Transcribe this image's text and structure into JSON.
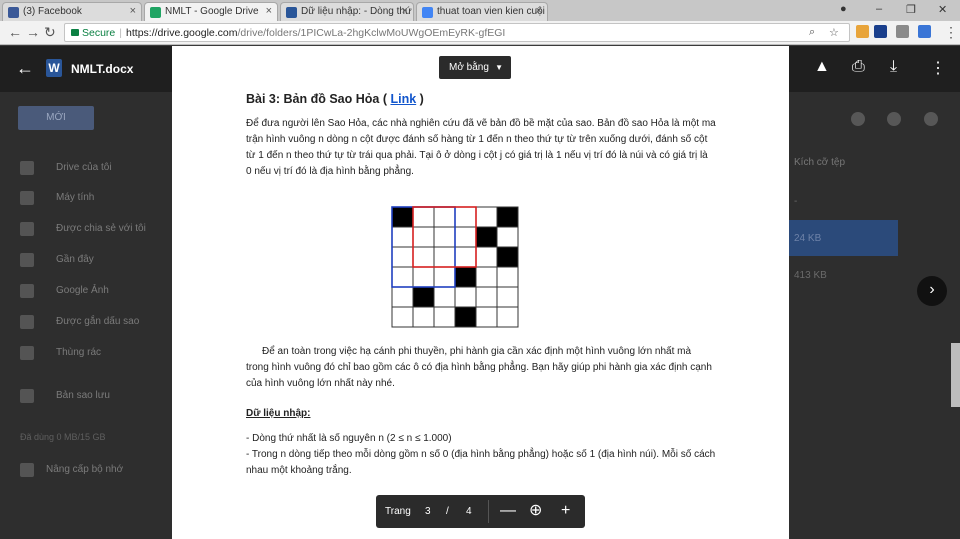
{
  "browser": {
    "tabs": [
      {
        "label": "(3) Facebook",
        "color": "#3b5998"
      },
      {
        "label": "NMLT - Google Drive",
        "color": "#1fa463"
      },
      {
        "label": "Dữ liệu nhập: - Dòng thứ",
        "color": "#2a5699"
      },
      {
        "label": "thuat toan vien kien cuội",
        "color": "#4285f4"
      }
    ],
    "secure_label": "Secure",
    "url_host": "https://drive.google.com",
    "url_path": "/drive/folders/1PICwLa-2hgKclwMoUWgOEmEyRK-gfEGI"
  },
  "drive": {
    "new_button": "MỚI",
    "sidebar": [
      {
        "label": "Drive của tôi"
      },
      {
        "label": "Máy tính"
      },
      {
        "label": "Được chia sẻ với tôi"
      },
      {
        "label": "Gần đây"
      },
      {
        "label": "Google Ảnh"
      },
      {
        "label": "Được gắn dấu sao"
      },
      {
        "label": "Thùng rác"
      },
      {
        "label": "Bản sao lưu"
      },
      {
        "label": "Nâng cấp bộ nhớ"
      }
    ],
    "storage_note": "Đã dùng 0 MB/15 GB",
    "size_header": "Kích cỡ tệp",
    "sizes": [
      "-",
      "24 KB",
      "413 KB"
    ]
  },
  "viewer": {
    "file_name": "NMLT.docx",
    "file_badge": "W",
    "open_with": "Mở bằng",
    "icons": [
      "back-arrow-icon",
      "add-to-drive-icon",
      "print-icon",
      "download-icon",
      "more-vert-icon"
    ]
  },
  "document": {
    "title_prefix": "Bài 3: Bản đồ Sao Hỏa (",
    "title_link": "Link",
    "title_suffix": ")",
    "para1": "Để đưa người lên Sao Hỏa, các nhà nghiên cứu đã vẽ bản đồ bề mặt của sao. Bản đồ sao Hỏa là một ma trận hình vuông n dòng n cột được đánh số hàng từ 1 đến n theo thứ tự từ trên xuống dưới, đánh số cột từ 1 đến n theo thứ tự từ trái qua phải. Tại ô ở dòng i cột j có giá trị là 1 nếu vị trí đó là núi và có giá trị là 0 nếu vị trí đó là địa hình bằng phẳng.",
    "para2": "Để an toàn trong việc hạ cánh phi thuyền, phi hành gia cần xác định một hình vuông lớn nhất mà trong hình vuông đó chỉ bao gồm các ô có địa hình bằng phẳng. Bạn hãy giúp phi hành gia xác định cạnh của hình vuông lớn nhất này nhé.",
    "input_heading": "Dữ liệu nhập:",
    "input_line1": "- Dòng thứ nhất là số nguyên n (2 ≤ n ≤ 1.000)",
    "input_line2": "- Trong n dòng tiếp theo mỗi dòng gồm n số 0 (địa hình bằng phẳng) hoặc số 1 (địa hình núi). Mỗi số cách nhau một khoảng trắng.",
    "grid": {
      "size": 6,
      "cells": [
        [
          1,
          0,
          0,
          0,
          0,
          1
        ],
        [
          0,
          0,
          0,
          0,
          1,
          0
        ],
        [
          0,
          0,
          0,
          0,
          0,
          1
        ],
        [
          0,
          0,
          0,
          1,
          0,
          0
        ],
        [
          0,
          1,
          0,
          0,
          0,
          0
        ],
        [
          0,
          0,
          0,
          1,
          0,
          0
        ]
      ],
      "highlight_blue": "#1f3fbf",
      "highlight_red": "#d62020"
    }
  },
  "pager": {
    "label": "Trang",
    "current": "3",
    "separator": "/",
    "total": "4"
  }
}
